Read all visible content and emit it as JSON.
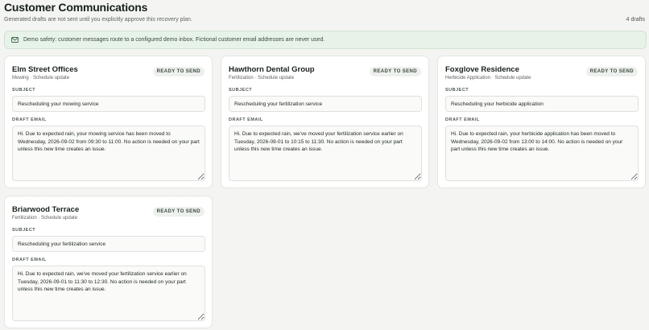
{
  "header": {
    "title": "Customer Communications",
    "subtitle": "Generated drafts are not sent until you explicitly approve this recovery plan.",
    "draft_count": "4 drafts"
  },
  "banner": {
    "icon": "mail-icon",
    "text": "Demo safety: customer messages route to a configured demo inbox. Fictional customer email addresses are never used.",
    "accent_color": "#e7f2e8"
  },
  "labels": {
    "subject": "SUBJECT",
    "draft_email": "DRAFT EMAIL"
  },
  "drafts": [
    {
      "customer": "Elm Street Offices",
      "meta": "Mowing · Schedule update",
      "status": "READY TO SEND",
      "subject": "Rescheduling your mowing service",
      "body": "Hi. Due to expected rain, your mowing service has been moved to Wednesday, 2026-09-02 from 09:30 to 11:00. No action is needed on your part unless this new time creates an issue."
    },
    {
      "customer": "Hawthorn Dental Group",
      "meta": "Fertilization · Schedule update",
      "status": "READY TO SEND",
      "subject": "Rescheduling your fertilization service",
      "body": "Hi. Due to expected rain, we've moved your fertilization service earlier on Tuesday, 2026-09-01 to 10:15 to 11:30. No action is needed on your part unless this new time creates an issue."
    },
    {
      "customer": "Foxglove Residence",
      "meta": "Herbicide Application · Schedule update",
      "status": "READY TO SEND",
      "subject": "Rescheduling your herbicide application",
      "body": "Hi. Due to expected rain, your herbicide application has been moved to Wednesday, 2026-09-02 from 13:00 to 14:00. No action is needed on your part unless this new time creates an issue."
    },
    {
      "customer": "Briarwood Terrace",
      "meta": "Fertilization · Schedule update",
      "status": "READY TO SEND",
      "subject": "Rescheduling your fertilization service",
      "body": "Hi. Due to expected rain, we've moved your fertilization service earlier on Tuesday, 2026-09-01 to 11:30 to 12:30. No action is needed on your part unless this new time creates an issue."
    }
  ]
}
